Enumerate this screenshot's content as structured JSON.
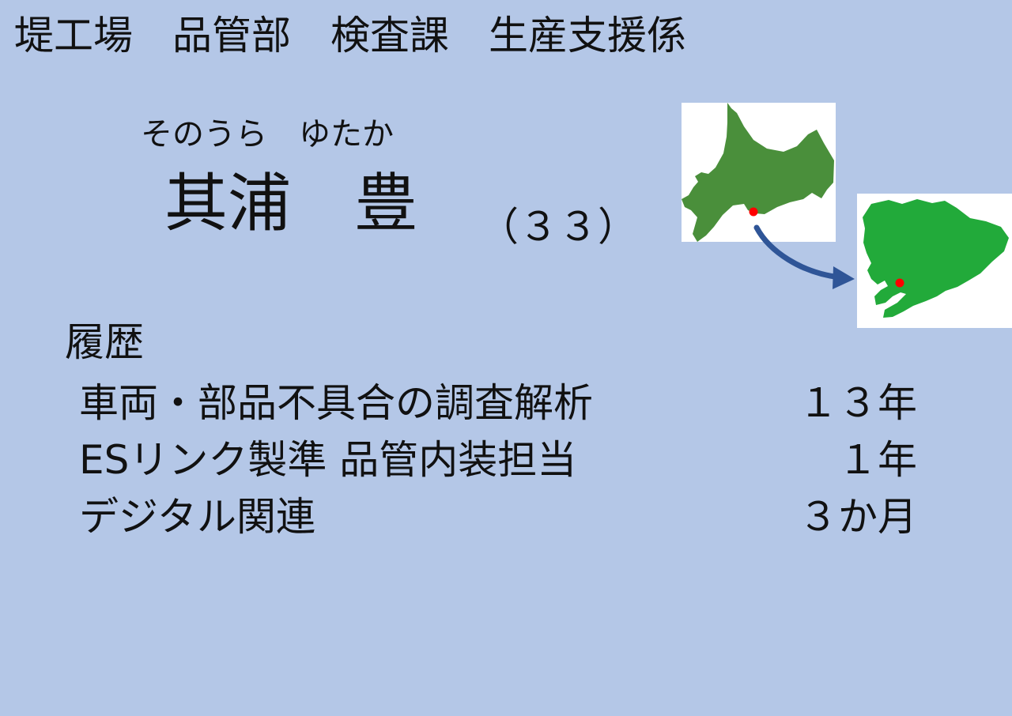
{
  "header": {
    "department_line": "堤工場　品管部　検査課　生産支援係"
  },
  "person": {
    "furigana": "そのうら　ゆたか",
    "name": "其浦　豊",
    "age": "（３３）"
  },
  "history": {
    "title": "履歴",
    "entries": [
      {
        "item": "車両・部品不具合の調査解析",
        "duration": "１３年"
      },
      {
        "item": "ESリンク製準 品管内装担当",
        "duration": "１年"
      },
      {
        "item": "デジタル関連",
        "duration": "３か月"
      }
    ]
  },
  "maps": {
    "icons": [
      "hokkaido-map-icon",
      "aichi-map-icon",
      "move-arrow-icon"
    ],
    "colors": {
      "background": "#b4c7e7",
      "hokkaido": "#4a8f3b",
      "aichi": "#22aa3a",
      "marker": "#ff0000",
      "arrow": "#2f5597"
    }
  }
}
